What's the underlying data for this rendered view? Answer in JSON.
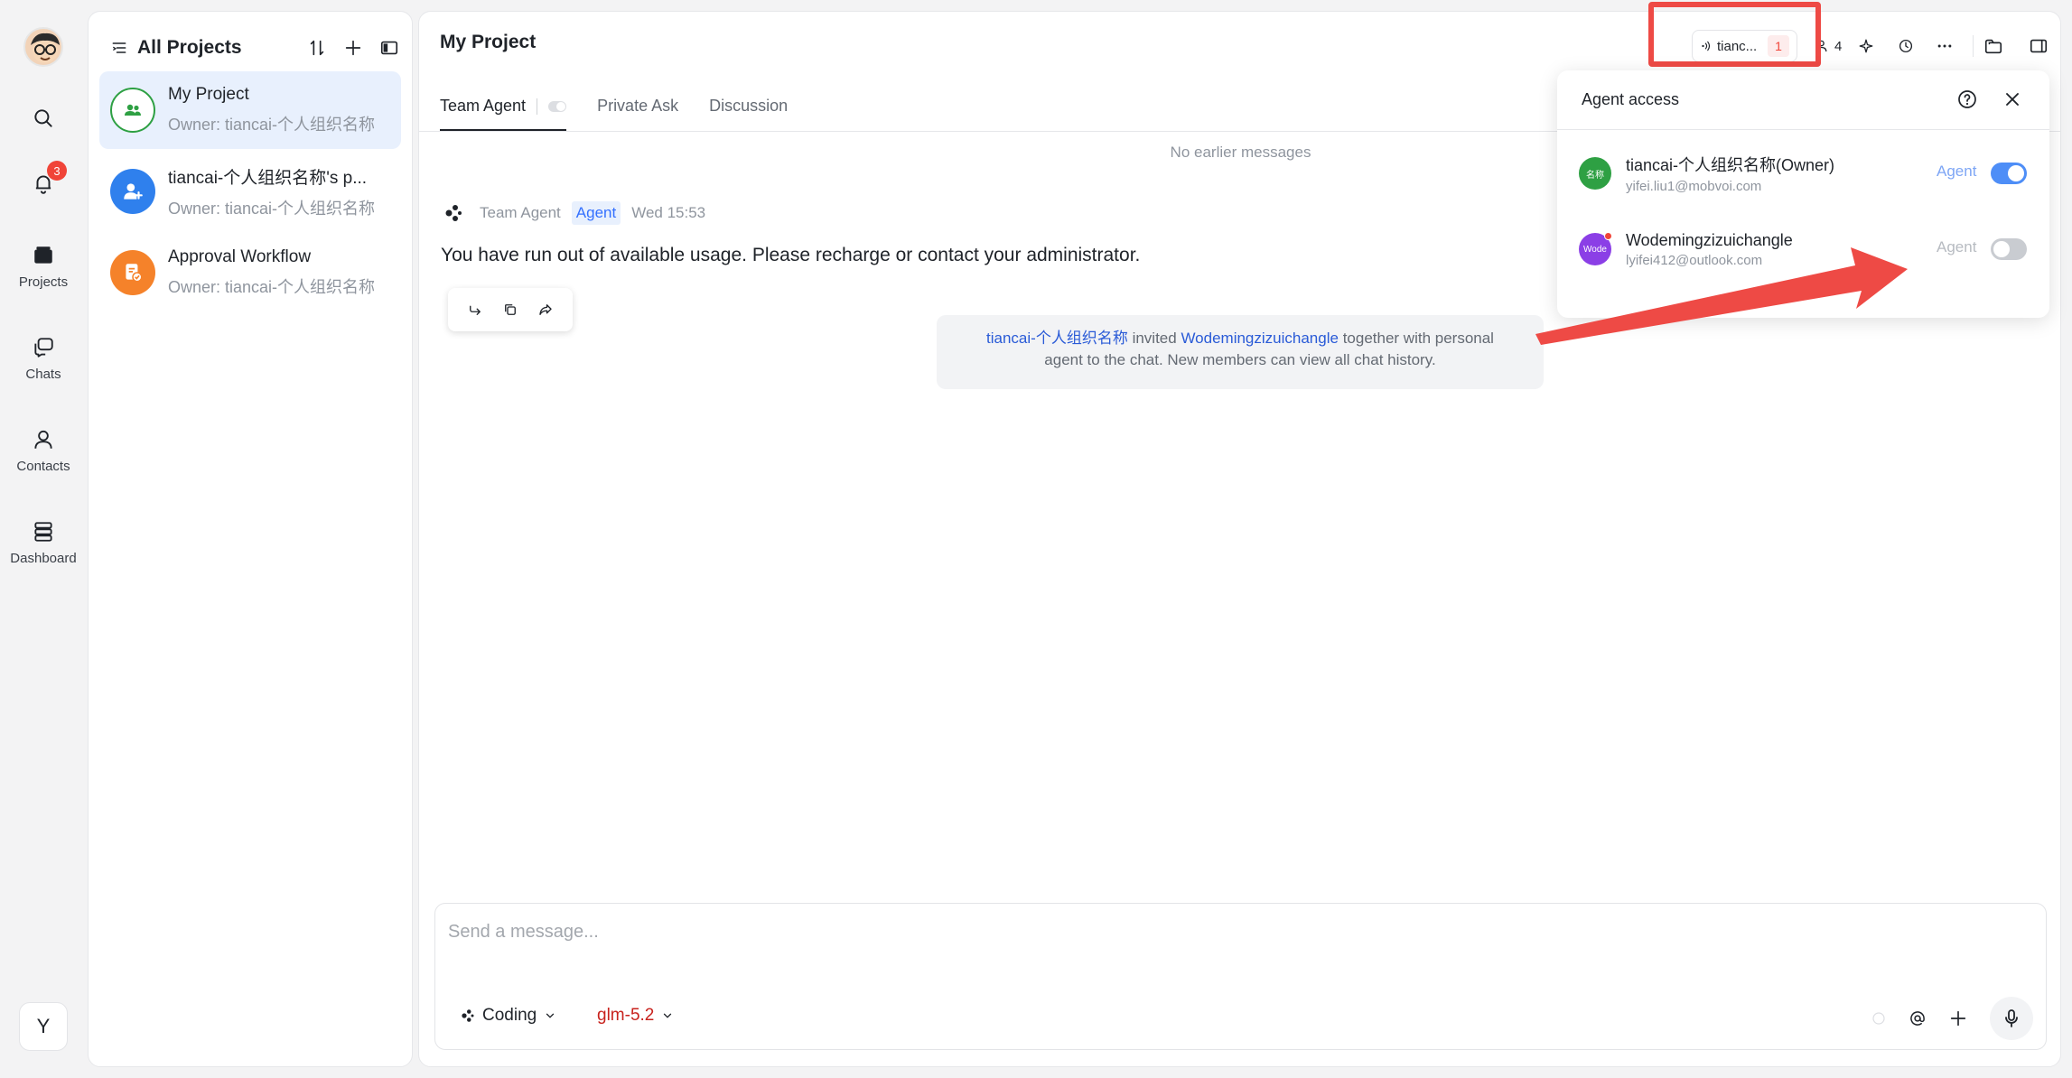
{
  "rail": {
    "badge": "3",
    "items": [
      {
        "label": "Projects"
      },
      {
        "label": "Chats"
      },
      {
        "label": "Contacts"
      },
      {
        "label": "Dashboard"
      }
    ],
    "user_initial": "Y"
  },
  "projects": {
    "header": "All Projects",
    "items": [
      {
        "name": "My Project",
        "owner": "Owner: tiancai-个人组织名称",
        "color": "#2ea043"
      },
      {
        "name": "tiancai-个人组织名称's p...",
        "owner": "Owner: tiancai-个人组织名称",
        "color": "#2f80ed"
      },
      {
        "name": "Approval Workflow",
        "owner": "Owner: tiancai-个人组织名称",
        "color": "#f5822a"
      }
    ]
  },
  "main": {
    "title": "My Project",
    "tabs": [
      {
        "label": "Team Agent"
      },
      {
        "label": "Private Ask"
      },
      {
        "label": "Discussion"
      }
    ],
    "no_earlier": "No earlier messages",
    "message": {
      "sender": "Team Agent",
      "tag": "Agent",
      "time": "Wed 15:53",
      "text": "You have run out of available usage. Please recharge or contact your administrator."
    },
    "system": {
      "inviter": "tiancai-个人组织名称",
      "invited_word": "invited",
      "invitee": "Wodemingzizuichangle",
      "rest_line1": "together with personal",
      "rest_line2": "agent to the chat. New members can view all chat history."
    }
  },
  "toolbar": {
    "chip_label": "tianc...",
    "chip_badge": "1",
    "members_count": "4"
  },
  "popover": {
    "title": "Agent access",
    "members": [
      {
        "avatar": "名称",
        "name": "tiancai-个人组织名称(Owner)",
        "email": "yifei.liu1@mobvoi.com",
        "agent": "Agent",
        "enabled": true,
        "color": "#2ea043"
      },
      {
        "avatar": "Wode",
        "name": "Wodemingzizuichangle",
        "email": "lyifei412@outlook.com",
        "agent": "Agent",
        "enabled": false,
        "color": "#8b3fe6"
      }
    ]
  },
  "composer": {
    "placeholder": "Send a message...",
    "mode": "Coding",
    "model": "glm-5.2"
  },
  "colors": {
    "accent": "#3370ff",
    "toggle_on": "#4e8ef7",
    "highlight": "#ee4a45"
  }
}
